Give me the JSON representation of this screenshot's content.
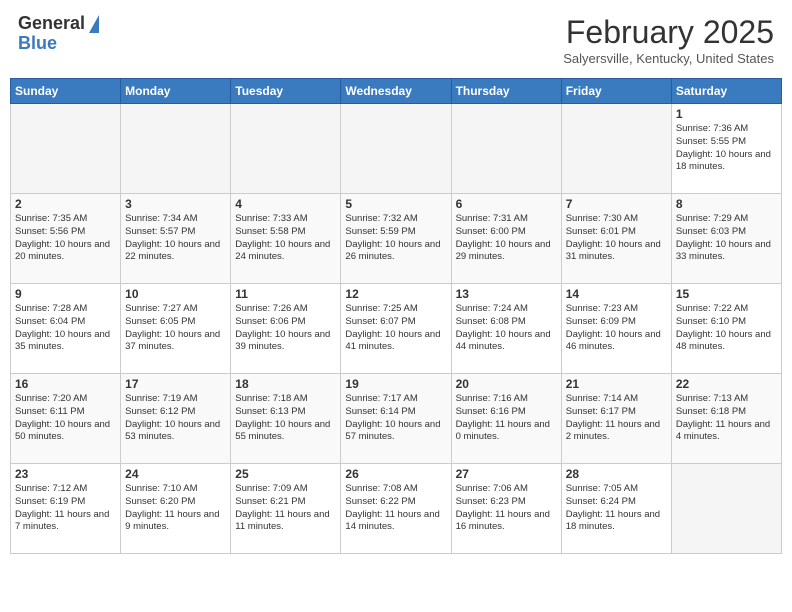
{
  "header": {
    "logo_general": "General",
    "logo_blue": "Blue",
    "month_title": "February 2025",
    "location": "Salyersville, Kentucky, United States"
  },
  "weekdays": [
    "Sunday",
    "Monday",
    "Tuesday",
    "Wednesday",
    "Thursday",
    "Friday",
    "Saturday"
  ],
  "weeks": [
    [
      {
        "day": "",
        "empty": true
      },
      {
        "day": "",
        "empty": true
      },
      {
        "day": "",
        "empty": true
      },
      {
        "day": "",
        "empty": true
      },
      {
        "day": "",
        "empty": true
      },
      {
        "day": "",
        "empty": true
      },
      {
        "day": "1",
        "sunrise": "7:36 AM",
        "sunset": "5:55 PM",
        "daylight": "10 hours and 18 minutes."
      }
    ],
    [
      {
        "day": "2",
        "sunrise": "7:35 AM",
        "sunset": "5:56 PM",
        "daylight": "10 hours and 20 minutes."
      },
      {
        "day": "3",
        "sunrise": "7:34 AM",
        "sunset": "5:57 PM",
        "daylight": "10 hours and 22 minutes."
      },
      {
        "day": "4",
        "sunrise": "7:33 AM",
        "sunset": "5:58 PM",
        "daylight": "10 hours and 24 minutes."
      },
      {
        "day": "5",
        "sunrise": "7:32 AM",
        "sunset": "5:59 PM",
        "daylight": "10 hours and 26 minutes."
      },
      {
        "day": "6",
        "sunrise": "7:31 AM",
        "sunset": "6:00 PM",
        "daylight": "10 hours and 29 minutes."
      },
      {
        "day": "7",
        "sunrise": "7:30 AM",
        "sunset": "6:01 PM",
        "daylight": "10 hours and 31 minutes."
      },
      {
        "day": "8",
        "sunrise": "7:29 AM",
        "sunset": "6:03 PM",
        "daylight": "10 hours and 33 minutes."
      }
    ],
    [
      {
        "day": "9",
        "sunrise": "7:28 AM",
        "sunset": "6:04 PM",
        "daylight": "10 hours and 35 minutes."
      },
      {
        "day": "10",
        "sunrise": "7:27 AM",
        "sunset": "6:05 PM",
        "daylight": "10 hours and 37 minutes."
      },
      {
        "day": "11",
        "sunrise": "7:26 AM",
        "sunset": "6:06 PM",
        "daylight": "10 hours and 39 minutes."
      },
      {
        "day": "12",
        "sunrise": "7:25 AM",
        "sunset": "6:07 PM",
        "daylight": "10 hours and 41 minutes."
      },
      {
        "day": "13",
        "sunrise": "7:24 AM",
        "sunset": "6:08 PM",
        "daylight": "10 hours and 44 minutes."
      },
      {
        "day": "14",
        "sunrise": "7:23 AM",
        "sunset": "6:09 PM",
        "daylight": "10 hours and 46 minutes."
      },
      {
        "day": "15",
        "sunrise": "7:22 AM",
        "sunset": "6:10 PM",
        "daylight": "10 hours and 48 minutes."
      }
    ],
    [
      {
        "day": "16",
        "sunrise": "7:20 AM",
        "sunset": "6:11 PM",
        "daylight": "10 hours and 50 minutes."
      },
      {
        "day": "17",
        "sunrise": "7:19 AM",
        "sunset": "6:12 PM",
        "daylight": "10 hours and 53 minutes."
      },
      {
        "day": "18",
        "sunrise": "7:18 AM",
        "sunset": "6:13 PM",
        "daylight": "10 hours and 55 minutes."
      },
      {
        "day": "19",
        "sunrise": "7:17 AM",
        "sunset": "6:14 PM",
        "daylight": "10 hours and 57 minutes."
      },
      {
        "day": "20",
        "sunrise": "7:16 AM",
        "sunset": "6:16 PM",
        "daylight": "11 hours and 0 minutes."
      },
      {
        "day": "21",
        "sunrise": "7:14 AM",
        "sunset": "6:17 PM",
        "daylight": "11 hours and 2 minutes."
      },
      {
        "day": "22",
        "sunrise": "7:13 AM",
        "sunset": "6:18 PM",
        "daylight": "11 hours and 4 minutes."
      }
    ],
    [
      {
        "day": "23",
        "sunrise": "7:12 AM",
        "sunset": "6:19 PM",
        "daylight": "11 hours and 7 minutes."
      },
      {
        "day": "24",
        "sunrise": "7:10 AM",
        "sunset": "6:20 PM",
        "daylight": "11 hours and 9 minutes."
      },
      {
        "day": "25",
        "sunrise": "7:09 AM",
        "sunset": "6:21 PM",
        "daylight": "11 hours and 11 minutes."
      },
      {
        "day": "26",
        "sunrise": "7:08 AM",
        "sunset": "6:22 PM",
        "daylight": "11 hours and 14 minutes."
      },
      {
        "day": "27",
        "sunrise": "7:06 AM",
        "sunset": "6:23 PM",
        "daylight": "11 hours and 16 minutes."
      },
      {
        "day": "28",
        "sunrise": "7:05 AM",
        "sunset": "6:24 PM",
        "daylight": "11 hours and 18 minutes."
      },
      {
        "day": "",
        "empty": true
      }
    ]
  ],
  "labels": {
    "sunrise": "Sunrise:",
    "sunset": "Sunset:",
    "daylight": "Daylight:"
  }
}
